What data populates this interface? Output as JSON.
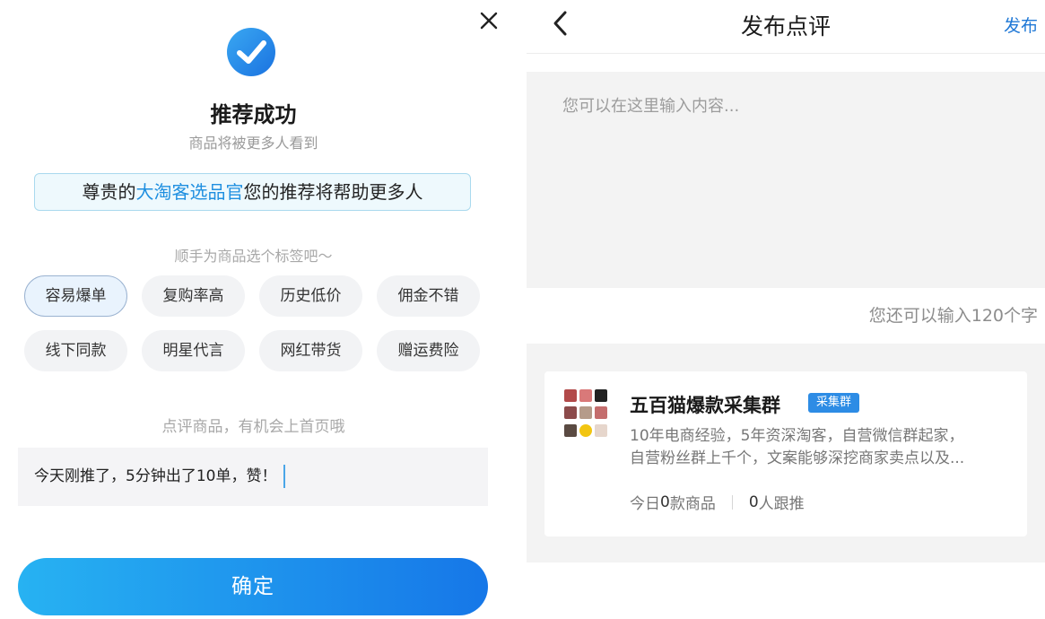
{
  "left": {
    "title": "推荐成功",
    "subtitle": "商品将被更多人看到",
    "banner": {
      "prefix": "尊贵的",
      "highlight": "大淘客选品官",
      "suffix": "您的推荐将帮助更多人"
    },
    "tag_hint": "顺手为商品选个标签吧～",
    "tags": [
      {
        "label": "容易爆单",
        "selected": true
      },
      {
        "label": "复购率高",
        "selected": false
      },
      {
        "label": "历史低价",
        "selected": false
      },
      {
        "label": "佣金不错",
        "selected": false
      },
      {
        "label": "线下同款",
        "selected": false
      },
      {
        "label": "明星代言",
        "selected": false
      },
      {
        "label": "网红带货",
        "selected": false
      },
      {
        "label": "赠运费险",
        "selected": false
      }
    ],
    "comment_hint": "点评商品，有机会上首页哦",
    "comment_value": "今天刚推了，5分钟出了10单，赞！",
    "confirm_label": "确定"
  },
  "right": {
    "nav_title": "发布点评",
    "publish_label": "发布",
    "placeholder": "您可以在这里输入内容...",
    "counter": "您还可以输入120个字",
    "group": {
      "name": "五百猫爆款采集群",
      "badge": "采集群",
      "desc_line1": "10年电商经验，5年资深淘客，自营微信群起家，",
      "desc_line2": "自营粉丝群上千个，文案能够深挖商家卖点以及...",
      "stat_today_prefix": "今日",
      "stat_today_num": "0",
      "stat_today_suffix": "款商品",
      "stat_follow_num": "0",
      "stat_follow_suffix": "人跟推"
    }
  },
  "colors": {
    "accent": "#1f8fe0",
    "button_start": "#27b2f2",
    "button_end": "#1677e8",
    "badge": "#2d8ce5"
  }
}
